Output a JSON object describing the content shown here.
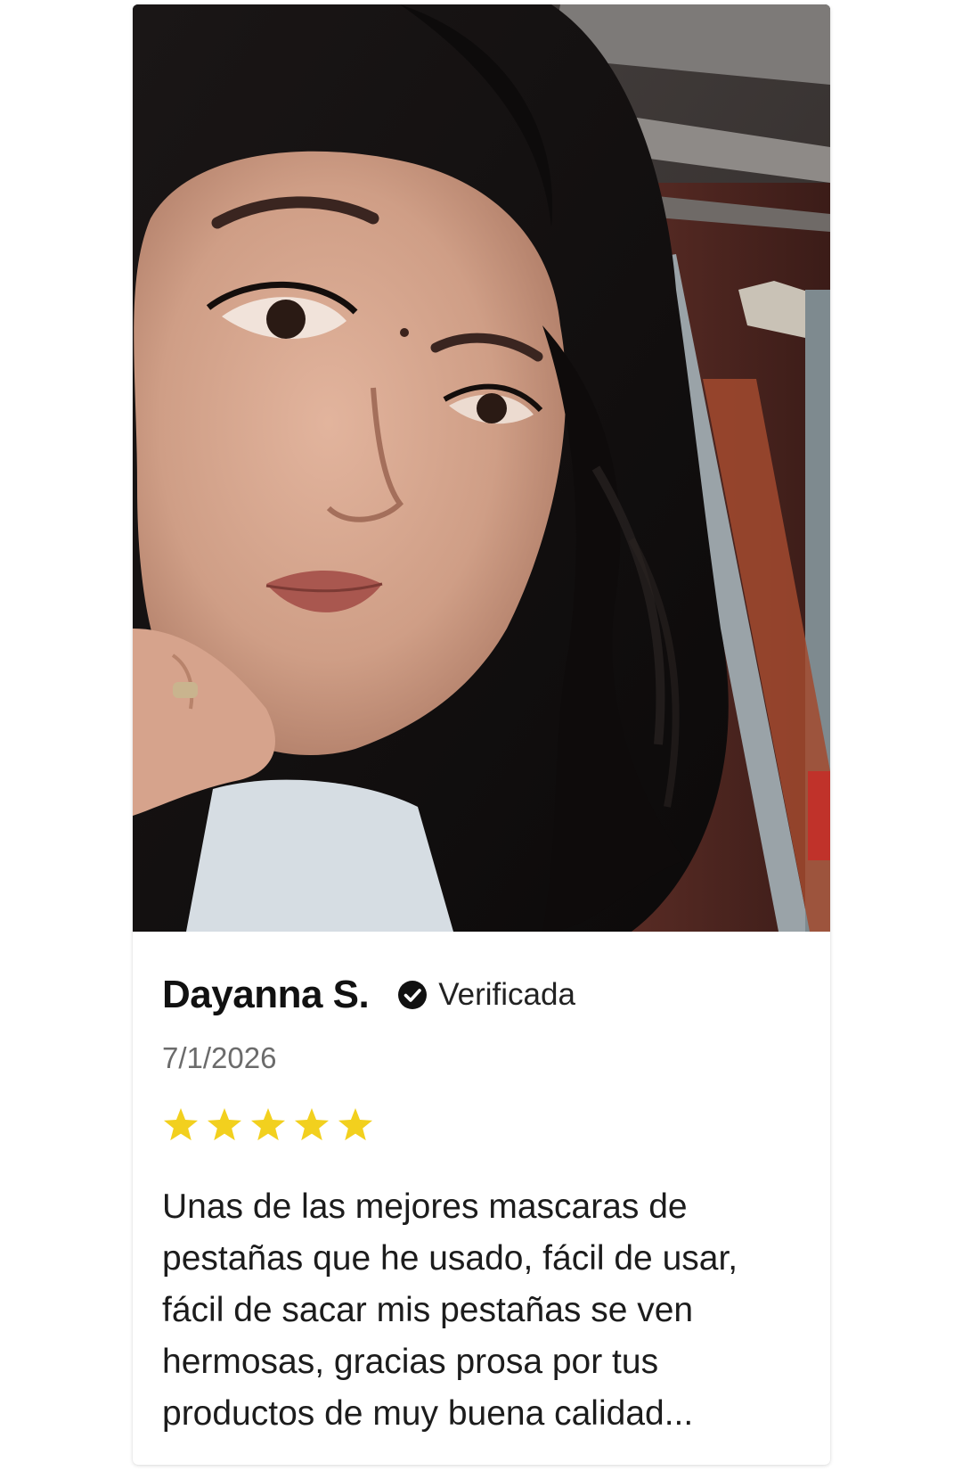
{
  "review": {
    "reviewer_name": "Dayanna S.",
    "verified_label": "Verificada",
    "date": "7/1/2026",
    "rating": 5,
    "rating_max": 5,
    "text": "Unas de las mejores mascaras de pestañas que he usado, fácil de usar, fácil de sacar mis pestañas se ven hermosas, gracias prosa por tus productos de muy buena calidad..."
  },
  "colors": {
    "star": "#F2D01E",
    "verified_icon": "#111111",
    "date_text": "#6B6B6B"
  },
  "icons": {
    "verified": "check-circle-icon",
    "star": "star-icon"
  }
}
